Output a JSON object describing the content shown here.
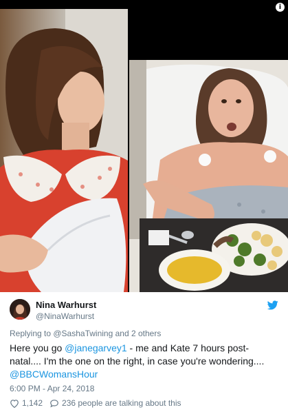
{
  "tweet": {
    "author_name": "Nina Warhurst",
    "author_handle": "@NinaWarhurst",
    "reply_prefix": "Replying to ",
    "reply_mention": "@SashaTwining",
    "reply_suffix": " and 2 others",
    "body_part1": "Here you go ",
    "body_mention1": "@janegarvey1",
    "body_part2": " - me and Kate 7 hours post-natal.... I'm the one on the right, in case you're wondering....",
    "body_mention2": "@BBCWomansHour",
    "timestamp": "6:00 PM - Apr 24, 2018",
    "likes": "1,142",
    "talking": "236 people are talking about this"
  },
  "icons": {
    "info": "info-icon",
    "brand": "twitter-bird-icon",
    "like": "heart-icon",
    "reply": "comment-bubble-icon"
  },
  "colors": {
    "link": "#1b95e0",
    "secondary": "#657786",
    "text": "#14171a"
  }
}
